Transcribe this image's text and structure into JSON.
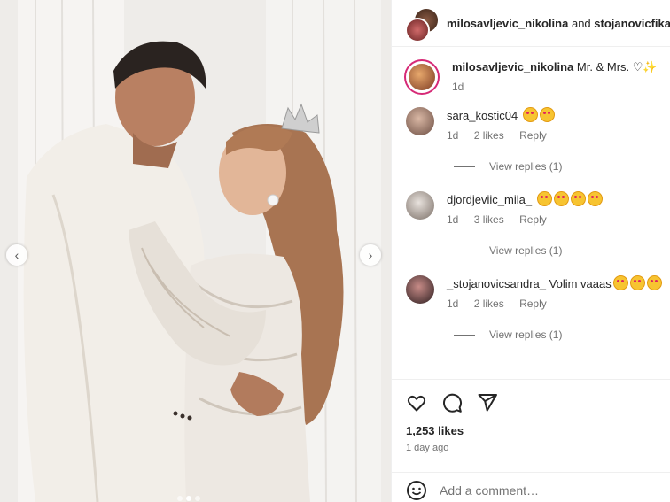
{
  "post": {
    "header": {
      "user1": "milosavljevic_nikolina",
      "joiner": "and",
      "user2": "stojanovicfika"
    },
    "carousel": {
      "slide_count": 3,
      "active_index": 1
    },
    "caption": {
      "username": "milosavljevic_nikolina",
      "text": "Mr. & Mrs.",
      "time": "1d"
    },
    "comments": [
      {
        "username": "sara_kostic04",
        "text": "",
        "emoji_count": 2,
        "time": "1d",
        "likes": "2 likes",
        "reply": "Reply",
        "view_replies": "View replies (1)"
      },
      {
        "username": "djordjeviic_mila_",
        "text": "",
        "emoji_count": 4,
        "time": "1d",
        "likes": "3 likes",
        "reply": "Reply",
        "view_replies": "View replies (1)"
      },
      {
        "username": "_stojanovicsandra_",
        "text": "Volim vaaas",
        "emoji_count": 3,
        "time": "1d",
        "likes": "2 likes",
        "reply": "Reply",
        "view_replies": "View replies (1)"
      }
    ],
    "likes": "1,253 likes",
    "posted": "1 day ago",
    "add_comment_placeholder": "Add a comment…",
    "icons": [
      "heart-icon",
      "comment-icon",
      "share-icon",
      "emoji-icon",
      "chevron-left-icon",
      "chevron-right-icon"
    ]
  }
}
